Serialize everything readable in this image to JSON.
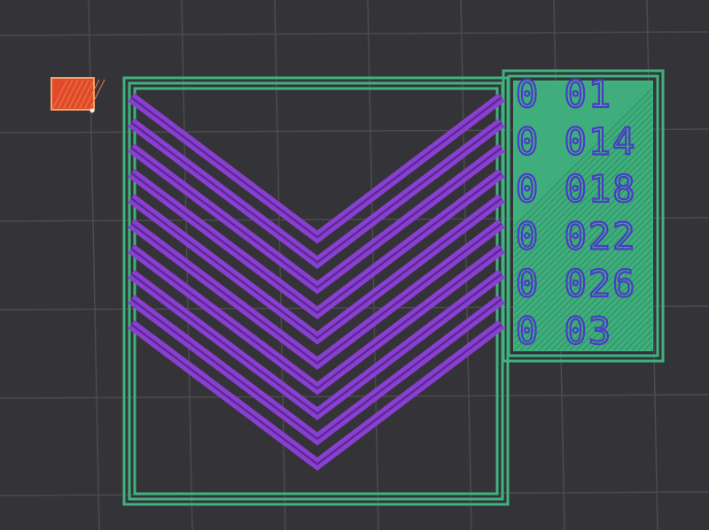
{
  "colors": {
    "background": "#343438",
    "grid": "#4a4a50",
    "perimeter": "#3fb27f",
    "perimeter_inner": "#2a2a2e",
    "chevron": "#8a3fd0",
    "chevron_dark": "#5a2a9a",
    "label_fill": "#3fae7c",
    "label_text": "#4b3bc9",
    "marker": "#e04a2a",
    "marker_edge": "#f2a56a"
  },
  "objects": {
    "marker_icon": "tool-origin-marker",
    "chevron_count": 10
  },
  "label_block": {
    "lines": [
      "0 01",
      "0 014",
      "0 018",
      "0 022",
      "0 026",
      "0 03"
    ]
  }
}
